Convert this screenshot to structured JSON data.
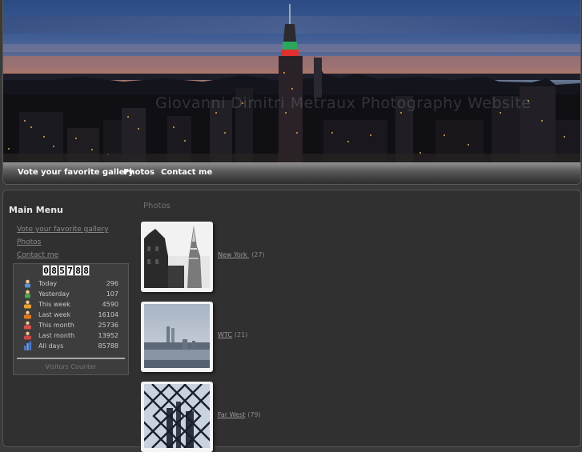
{
  "header": {
    "site_title": "Giovanni Dimitri Metraux Photography Website"
  },
  "nav": {
    "items": [
      "Vote your favorite gallery",
      "Photos",
      "Contact me"
    ]
  },
  "sidebar": {
    "title": "Main Menu",
    "links": [
      "Vote your favorite gallery",
      "Photos",
      "Contact me"
    ],
    "counter": {
      "digits": [
        "0",
        "8",
        "5",
        "7",
        "8",
        "8"
      ],
      "stats": [
        {
          "label": "Today",
          "value": "296",
          "icon": "person-icon",
          "color": "#5b8fd6"
        },
        {
          "label": "Yesterday",
          "value": "107",
          "icon": "person-icon",
          "color": "#4aa84a"
        },
        {
          "label": "This week",
          "value": "4590",
          "icon": "group-icon",
          "color": "#e8a030"
        },
        {
          "label": "Last week",
          "value": "16104",
          "icon": "group-icon",
          "color": "#e07a20"
        },
        {
          "label": "This month",
          "value": "25736",
          "icon": "group-icon",
          "color": "#d85050"
        },
        {
          "label": "Last month",
          "value": "13952",
          "icon": "group-icon",
          "color": "#c84848"
        },
        {
          "label": "All days",
          "value": "85788",
          "icon": "bar-chart-icon",
          "color": "#4a7ad0"
        }
      ],
      "caption": "Visitors Counter"
    }
  },
  "content": {
    "title": "Photos",
    "galleries": [
      {
        "name": "New York ",
        "count": "(27)"
      },
      {
        "name": "WTC",
        "count": "(21)"
      },
      {
        "name": "Far West",
        "count": "(79)"
      }
    ]
  }
}
